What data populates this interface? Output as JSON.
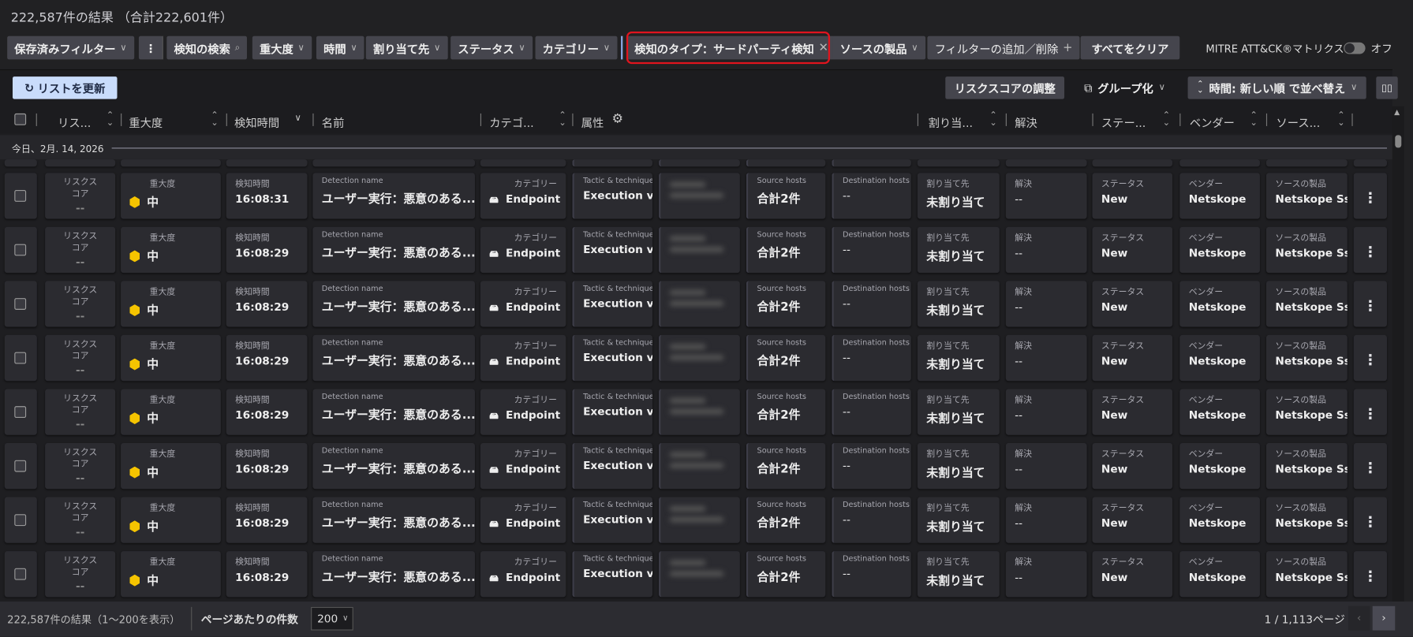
{
  "title": "222,587件の結果 （合計222,601件）",
  "filters": {
    "saved": "保存済みフィルター",
    "items": [
      {
        "label": "検知の検索",
        "icon": "search-icon"
      },
      {
        "label": "重大度"
      },
      {
        "label": "時間"
      },
      {
        "label": "割り当て先"
      },
      {
        "label": "ステータス"
      },
      {
        "label": "カテゴリー"
      }
    ],
    "active": "検知のタイプ：サードパーティ検知",
    "product": "ソースの製品",
    "add_remove": "フィルターの追加／削除",
    "clear_all": "すべてをクリア",
    "mitre_label": "MITRE ATT&CK®マトリクス",
    "mitre_state": "オフ",
    "mitre_on": false
  },
  "toolbar": {
    "refresh": "リストを更新",
    "risk_adjust": "リスクスコアの調整",
    "group": "グループ化",
    "sort": "時間: 新しい順 で並べ替え"
  },
  "columns": [
    "リス...",
    "重大度",
    "検知時間",
    "名前",
    "カテゴ...",
    "属性",
    "割り当...",
    "解決",
    "ステー...",
    "ベンダー",
    "ソース..."
  ],
  "date_group": "今日、2月. 14, 2026",
  "row_labels": {
    "risk": "リスクス\nコア",
    "severity": "重大度",
    "time": "検知時間",
    "name": "Detection name",
    "category": "カテゴリー",
    "tactic": "Tactic & technique",
    "source_hosts": "Source hosts",
    "dest_hosts": "Destination hosts",
    "assignee": "割り当て先",
    "resolution": "解決",
    "status": "ステータス",
    "vendor": "ベンダー",
    "product": "ソースの製品"
  },
  "rows": [
    {
      "risk": "--",
      "severity": "中",
      "time": "16:08:31",
      "name": "ユーザー実行：悪意のある...",
      "category": "Endpoint",
      "tactic": "Execution vi...",
      "source_hosts": "合計2件",
      "dest_hosts": "--",
      "assignee": "未割り当て",
      "resolution": "--",
      "status": "New",
      "vendor": "Netskope",
      "product": "Netskope Sse"
    },
    {
      "risk": "--",
      "severity": "中",
      "time": "16:08:29",
      "name": "ユーザー実行：悪意のある...",
      "category": "Endpoint",
      "tactic": "Execution vi...",
      "source_hosts": "合計2件",
      "dest_hosts": "--",
      "assignee": "未割り当て",
      "resolution": "--",
      "status": "New",
      "vendor": "Netskope",
      "product": "Netskope Sse"
    },
    {
      "risk": "--",
      "severity": "中",
      "time": "16:08:29",
      "name": "ユーザー実行：悪意のある...",
      "category": "Endpoint",
      "tactic": "Execution vi...",
      "source_hosts": "合計2件",
      "dest_hosts": "--",
      "assignee": "未割り当て",
      "resolution": "--",
      "status": "New",
      "vendor": "Netskope",
      "product": "Netskope Sse"
    },
    {
      "risk": "--",
      "severity": "中",
      "time": "16:08:29",
      "name": "ユーザー実行：悪意のある...",
      "category": "Endpoint",
      "tactic": "Execution vi...",
      "source_hosts": "合計2件",
      "dest_hosts": "--",
      "assignee": "未割り当て",
      "resolution": "--",
      "status": "New",
      "vendor": "Netskope",
      "product": "Netskope Sse"
    },
    {
      "risk": "--",
      "severity": "中",
      "time": "16:08:29",
      "name": "ユーザー実行：悪意のある...",
      "category": "Endpoint",
      "tactic": "Execution vi...",
      "source_hosts": "合計2件",
      "dest_hosts": "--",
      "assignee": "未割り当て",
      "resolution": "--",
      "status": "New",
      "vendor": "Netskope",
      "product": "Netskope Sse"
    },
    {
      "risk": "--",
      "severity": "中",
      "time": "16:08:29",
      "name": "ユーザー実行：悪意のある...",
      "category": "Endpoint",
      "tactic": "Execution vi...",
      "source_hosts": "合計2件",
      "dest_hosts": "--",
      "assignee": "未割り当て",
      "resolution": "--",
      "status": "New",
      "vendor": "Netskope",
      "product": "Netskope Sse"
    },
    {
      "risk": "--",
      "severity": "中",
      "time": "16:08:29",
      "name": "ユーザー実行：悪意のある...",
      "category": "Endpoint",
      "tactic": "Execution vi...",
      "source_hosts": "合計2件",
      "dest_hosts": "--",
      "assignee": "未割り当て",
      "resolution": "--",
      "status": "New",
      "vendor": "Netskope",
      "product": "Netskope Sse"
    },
    {
      "risk": "--",
      "severity": "中",
      "time": "16:08:29",
      "name": "ユーザー実行：悪意のある...",
      "category": "Endpoint",
      "tactic": "Execution vi...",
      "source_hosts": "合計2件",
      "dest_hosts": "--",
      "assignee": "未割り当て",
      "resolution": "--",
      "status": "New",
      "vendor": "Netskope",
      "product": "Netskope Sse"
    }
  ],
  "severity_color": "#f5c400",
  "footer": {
    "summary": "222,587件の結果（1〜200を表示）",
    "per_page_label": "ページあたりの件数",
    "per_page": "200",
    "page": "1 / 1,113ページ"
  }
}
